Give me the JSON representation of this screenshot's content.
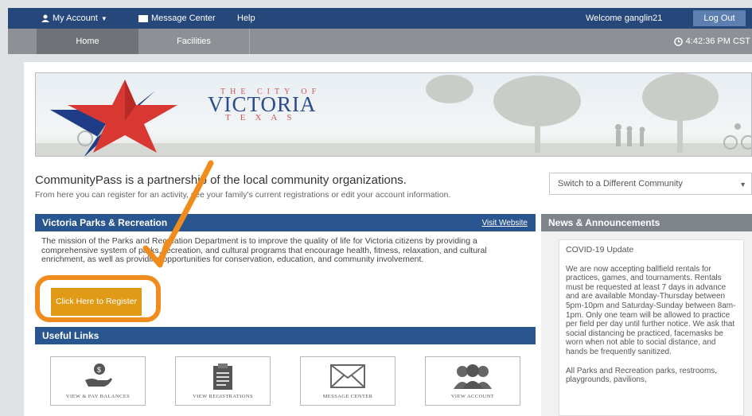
{
  "topbar": {
    "my_account": "My Account",
    "message_center": "Message Center",
    "help": "Help",
    "welcome": "Welcome ganglin21",
    "logout": "Log Out"
  },
  "nav": {
    "home": "Home",
    "facilities": "Facilities",
    "time": "4:42:36 PM CST"
  },
  "banner": {
    "city_line": "THE CITY OF",
    "city_name": "VICTORIA",
    "state": "TEXAS"
  },
  "intro": {
    "title": "CommunityPass is a partnership of the local community organizations.",
    "subtitle": "From here you can register for an activity, see your family's current registrations or edit your account information."
  },
  "community_select": {
    "label": "Switch to a Different Community"
  },
  "org": {
    "name": "Victoria Parks & Recreation",
    "visit": "Visit Website",
    "mission": "The mission of the Parks and Recreation Department is to improve the quality of life for Victoria citizens by providing a comprehensive system of parks, recreation, and cultural programs that encourage health, fitness, relaxation, and cultural enrichment, as well as providing opportunities for conservation, education, and community involvement.",
    "register_button": "Click Here to Register"
  },
  "useful_links": {
    "title": "Useful Links",
    "items": [
      {
        "label": "VIEW & PAY BALANCES",
        "icon": "hand-money-icon"
      },
      {
        "label": "VIEW REGISTRATIONS",
        "icon": "clipboard-icon"
      },
      {
        "label": "MESSAGE CENTER",
        "icon": "envelope-icon"
      },
      {
        "label": "VIEW ACCOUNT",
        "icon": "users-icon"
      }
    ]
  },
  "news": {
    "title": "News & Announcements",
    "heading": "COVID-19 Update",
    "body": "We are now accepting ballfield rentals for practices, games, and tournaments. Rentals must be requested at least 7 days in advance and are available Monday-Thursday between 5pm-10pm and Saturday-Sunday between 8am-1pm. Only one team will be allowed to practice per field per day until further notice. We ask that social distancing be practiced, facemasks be worn when not able to social distance, and hands be frequently sanitized.",
    "body2": "All Parks and Recreation parks, restrooms, playgrounds, pavilions,"
  },
  "colors": {
    "topbar": "#26477a",
    "section_blue": "#2a568f",
    "register_orange": "#e09a16",
    "annotation_orange": "#f08c1e"
  }
}
